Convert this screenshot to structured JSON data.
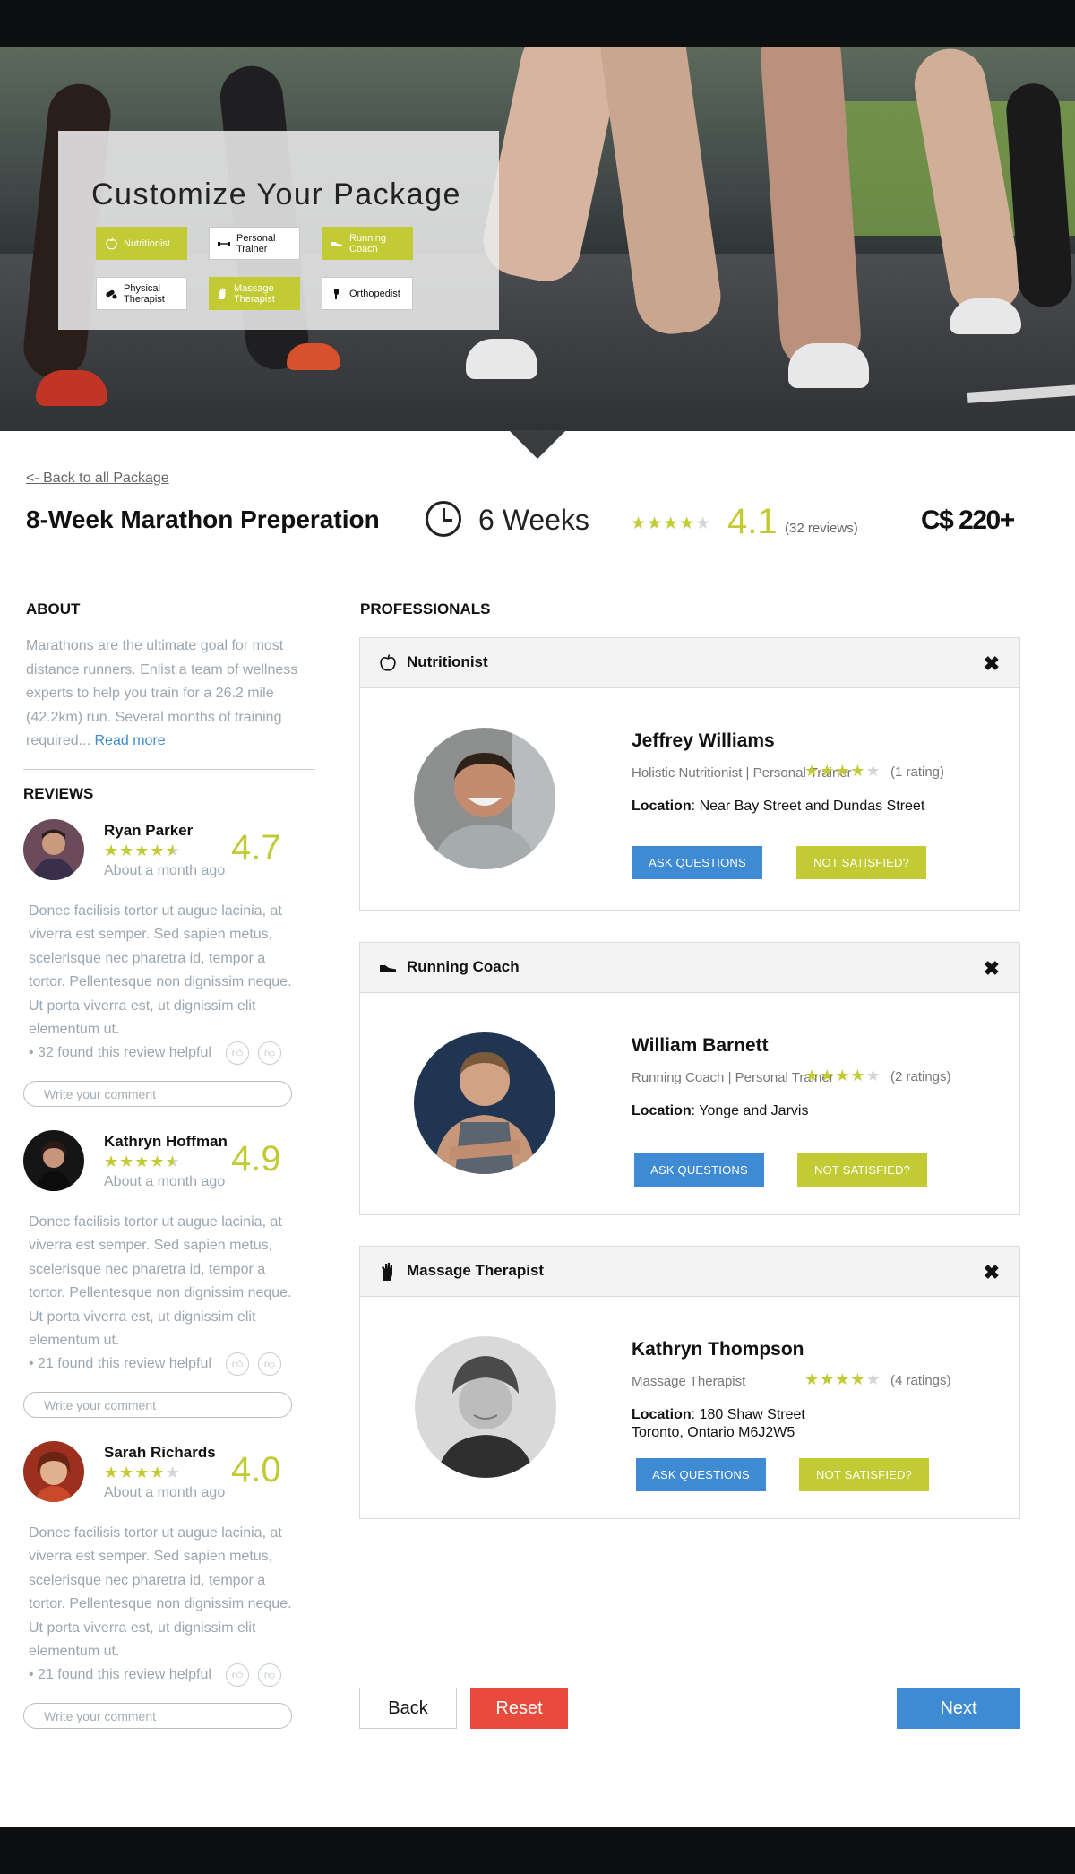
{
  "hero": {
    "title": "Customize Your Package",
    "chips": [
      {
        "label": "Nutritionist",
        "icon": "apple-icon",
        "selected": true
      },
      {
        "label": "Personal Trainer",
        "icon": "dumbbell-icon",
        "selected": false
      },
      {
        "label": "Running Coach",
        "icon": "shoe-icon",
        "selected": true
      },
      {
        "label": "Physical Therapist",
        "icon": "pill-icon",
        "selected": false
      },
      {
        "label": "Massage Therapist",
        "icon": "hand-icon",
        "selected": true
      },
      {
        "label": "Orthopedist",
        "icon": "foot-icon",
        "selected": false
      }
    ]
  },
  "header": {
    "back_link": "<- Back to all Package",
    "package_name": "8-Week Marathon Preperation",
    "duration": "6 Weeks",
    "rating_stars": 4,
    "rating_score": "4.1",
    "reviews_count": "(32 reviews)",
    "price": "C$ 220+"
  },
  "about": {
    "heading": "ABOUT",
    "text": "Marathons are the ultimate goal for most distance runners. Enlist a team of wellness experts to help you train for a 26.2 mile (42.2km) run. Several months of training required...",
    "read_more": "Read more"
  },
  "reviews": {
    "heading": "REVIEWS",
    "items": [
      {
        "name": "Ryan Parker",
        "stars": 4.5,
        "score": "4.7",
        "when": "About a month ago",
        "body": "Donec facilisis tortor ut augue lacinia, at viverra est semper. Sed sapien metus, scelerisque nec pharetra id, tempor a tortor. Pellentesque non dignissim neque. Ut porta viverra est, ut dignissim elit elementum ut.",
        "helpful": "• 32 found this review helpful",
        "comment_placeholder": "Write your comment"
      },
      {
        "name": "Kathryn Hoffman",
        "stars": 4.5,
        "score": "4.9",
        "when": "About a month ago",
        "body": "Donec facilisis tortor ut augue lacinia, at viverra est semper. Sed sapien metus, scelerisque nec pharetra id, tempor a tortor. Pellentesque non dignissim neque. Ut porta viverra est, ut dignissim elit elementum ut.",
        "helpful": "• 21 found this review helpful",
        "comment_placeholder": "Write your comment"
      },
      {
        "name": "Sarah Richards",
        "stars": 4,
        "score": "4.0",
        "when": "About a month ago",
        "body": "Donec facilisis tortor ut augue lacinia, at viverra est semper. Sed sapien metus, scelerisque nec pharetra id, tempor a tortor. Pellentesque non dignissim neque. Ut porta viverra est, ut dignissim elit elementum ut.",
        "helpful": "• 21 found this review helpful",
        "comment_placeholder": "Write your comment"
      }
    ]
  },
  "professionals": {
    "heading": "PROFESSIONALS",
    "items": [
      {
        "category": "Nutritionist",
        "icon": "apple-icon",
        "name": "Jeffrey Williams",
        "role": "Holistic Nutritionist | Personal Trainer",
        "stars": 4,
        "ratings": "(1 rating)",
        "location_label": "Location",
        "location": "Near Bay Street and Dundas Street",
        "location_line2": "",
        "ask_label": "ASK QUESTIONS",
        "ns_label": "NOT SATISFIED?"
      },
      {
        "category": "Running Coach",
        "icon": "shoe-icon",
        "name": "William Barnett",
        "role": "Running Coach | Personal Trainer",
        "stars": 4,
        "ratings": "(2 ratings)",
        "location_label": "Location",
        "location": "Yonge and Jarvis",
        "location_line2": "",
        "ask_label": "ASK QUESTIONS",
        "ns_label": "NOT SATISFIED?"
      },
      {
        "category": "Massage Therapist",
        "icon": "hand-icon",
        "name": "Kathryn Thompson",
        "role": "Massage Therapist",
        "stars": 4,
        "ratings": "(4 ratings)",
        "location_label": "Location",
        "location": "180 Shaw Street",
        "location_line2": "Toronto, Ontario M6J2W5",
        "ask_label": "ASK QUESTIONS",
        "ns_label": "NOT SATISFIED?"
      }
    ]
  },
  "nav": {
    "back": "Back",
    "reset": "Reset",
    "next": "Next"
  },
  "colors": {
    "accent_green": "#c2cb34",
    "accent_blue": "#3e8ad3",
    "reset_red": "#e84b3c"
  }
}
